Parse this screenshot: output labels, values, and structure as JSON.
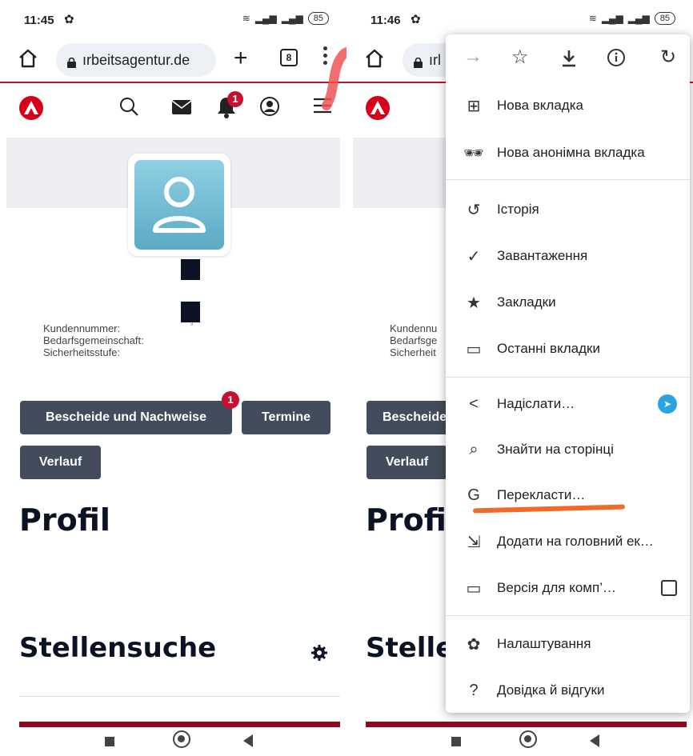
{
  "left": {
    "status": {
      "time": "11:45",
      "battery": "85"
    },
    "browser": {
      "url": "ırbeitsagentur.de",
      "tab_count": "8",
      "new_tab": "+"
    },
    "header": {
      "badge": "1"
    },
    "profile": {
      "meta_labels": [
        "Kundennummer:",
        "Bedarfsgemeinschaft:",
        "Sicherheitsstufe:"
      ],
      "meta_small": "³"
    },
    "buttons": {
      "bescheide": "Bescheide und Nachweise",
      "bescheide_badge": "1",
      "termine": "Termine",
      "verlauf": "Verlauf"
    },
    "headings": {
      "profil": "Profil",
      "stellensuche": "Stellensuche"
    }
  },
  "right": {
    "status": {
      "time": "11:46",
      "battery": "85"
    },
    "browser": {
      "url": "ırl"
    },
    "profile": {
      "meta_labels": [
        "Kundennu",
        "Bedarfsge",
        "Sicherheit"
      ]
    },
    "buttons": {
      "bescheide": "Bescheide",
      "verlauf": "Verlauf"
    },
    "headings": {
      "profil": "Profil",
      "stellensuche": "Steller"
    }
  },
  "menu": {
    "toolbar": [
      "forward",
      "star",
      "download",
      "info",
      "refresh"
    ],
    "items": [
      {
        "label": "Нова вкладка",
        "icon": "new-tab-icon"
      },
      {
        "label": "Нова анонімна вкладка",
        "icon": "incognito-icon"
      },
      {
        "label": "Історія",
        "icon": "history-icon"
      },
      {
        "label": "Завантаження",
        "icon": "downloads-icon"
      },
      {
        "label": "Закладки",
        "icon": "bookmarks-icon"
      },
      {
        "label": "Останні вкладки",
        "icon": "recent-tabs-icon"
      },
      {
        "label": "Надіслати…",
        "icon": "share-icon"
      },
      {
        "label": "Знайти на сторінці",
        "icon": "find-icon"
      },
      {
        "label": "Перекласти…",
        "icon": "translate-icon"
      },
      {
        "label": "Додати на головний ек…",
        "icon": "add-home-icon"
      },
      {
        "label": "Версія для комп’…",
        "icon": "desktop-icon"
      },
      {
        "label": "Налаштування",
        "icon": "settings-icon"
      },
      {
        "label": "Довідка й відгуки",
        "icon": "help-icon"
      }
    ]
  },
  "colors": {
    "brand_red": "#c8102e",
    "button_bg": "#434c5c",
    "heading": "#0b1224",
    "annotation": "#f06a2b"
  }
}
